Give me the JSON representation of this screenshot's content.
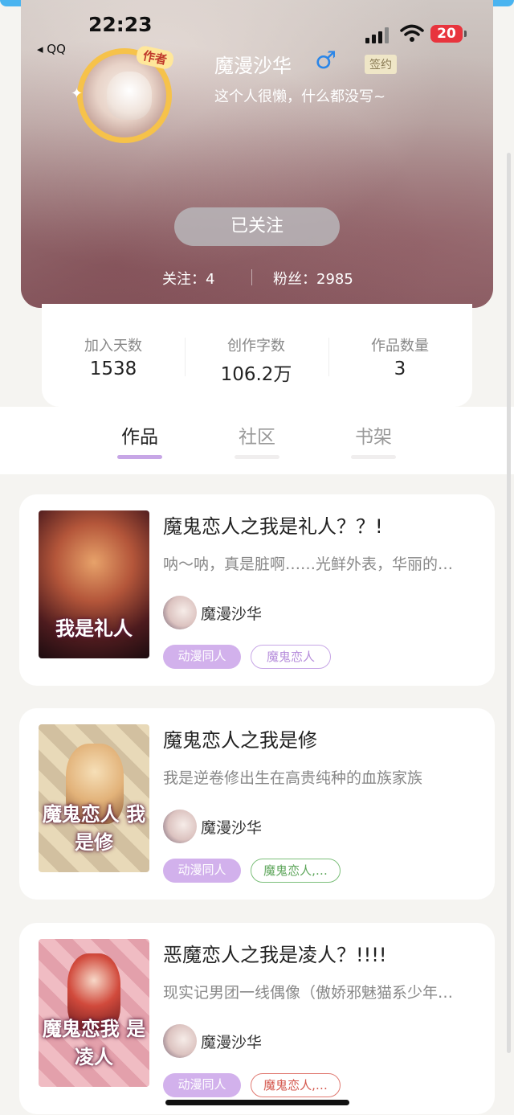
{
  "status_bar": {
    "time": "22:23",
    "back_app": "◂ QQ",
    "battery": "20"
  },
  "profile": {
    "username": "魔漫沙华",
    "gender_symbol": "♂",
    "signed_badge": "签约",
    "author_badge": "作者",
    "bio": "这个人很懒，什么都没写~",
    "follow_button": "已关注",
    "following": "关注：4",
    "followers": "粉丝：2985"
  },
  "stats": [
    {
      "label": "加入天数",
      "value": "1538"
    },
    {
      "label": "创作字数",
      "value": "106.2万"
    },
    {
      "label": "作品数量",
      "value": "3"
    }
  ],
  "tabs": [
    {
      "label": "作品",
      "active": true
    },
    {
      "label": "社区",
      "active": false
    },
    {
      "label": "书架",
      "active": false
    }
  ],
  "books": [
    {
      "title": "魔鬼恋人之我是礼人？？!",
      "desc": "呐～呐，真是脏啊……光鲜外表，华丽的…",
      "author": "魔漫沙华",
      "cover_title": "我是礼人",
      "tags": [
        "动漫同人",
        "魔鬼恋人"
      ],
      "tag2_color": "#c7a6e6"
    },
    {
      "title": "魔鬼恋人之我是修",
      "desc": "我是逆卷修出生在高贵纯种的血族家族",
      "author": "魔漫沙华",
      "cover_title": "魔鬼恋人 我是修",
      "tags": [
        "动漫同人",
        "魔鬼恋人,…"
      ],
      "tag2_color": "#7cbf7a"
    },
    {
      "title": "恶魔恋人之我是凌人？!!!!",
      "desc": "现实记男团一线偶像（傲娇邪魅猫系少年…",
      "author": "魔漫沙华",
      "cover_title": "魔鬼恋我 是凌人",
      "tags": [
        "动漫同人",
        "魔鬼恋人,…"
      ],
      "tag2_color": "#e07a72"
    }
  ]
}
